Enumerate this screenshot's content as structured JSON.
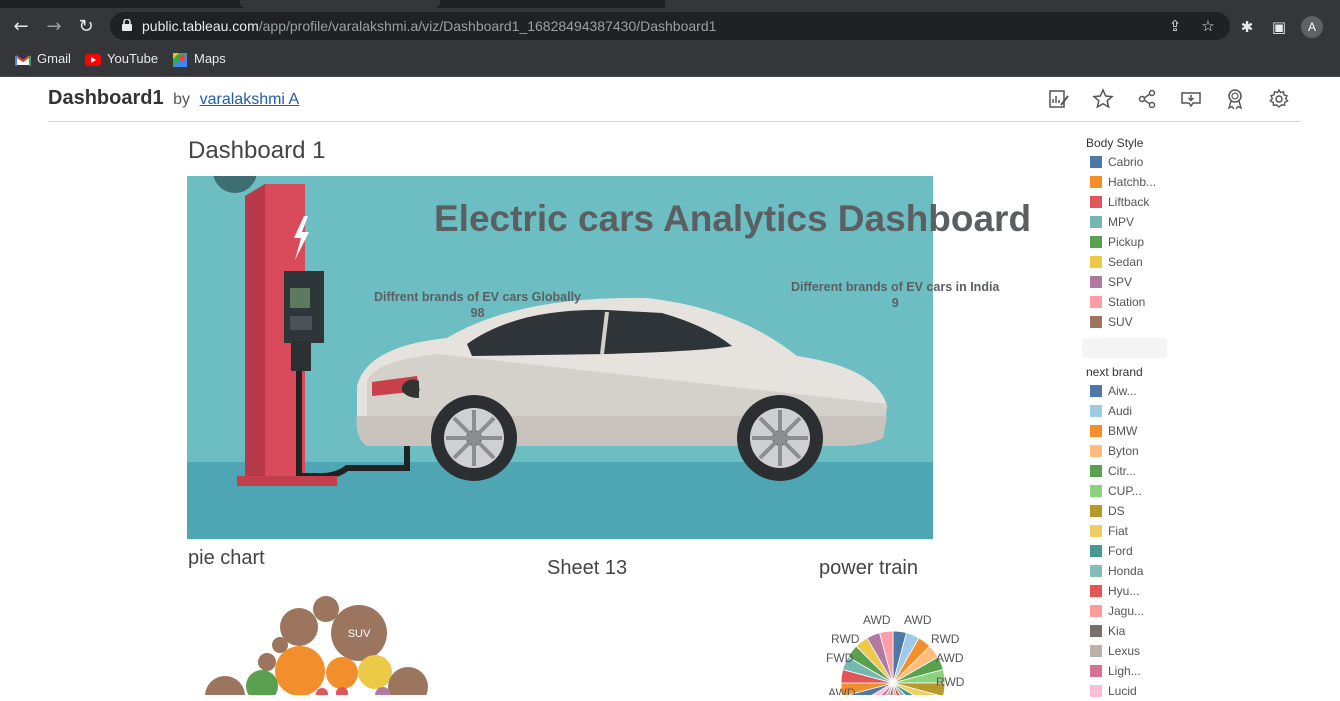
{
  "browser": {
    "url_host": "public.tableau.com",
    "url_path": "/app/profile/varalakshmi.a/viz/Dashboard1_16828494387430/Dashboard1",
    "profile_initial": "A",
    "bookmarks": [
      "Gmail",
      "YouTube",
      "Maps"
    ]
  },
  "viz": {
    "title": "Dashboard1",
    "by": "by",
    "author": "varalakshmi A"
  },
  "dashboard": {
    "title": "Dashboard 1",
    "main_title": "Electric cars Analytics Dashboard",
    "kpi_global_label": "Diffrent brands of EV cars Globally",
    "kpi_global_value": "98",
    "kpi_india_label": "Different brands of EV cars in India",
    "kpi_india_value": "9",
    "sheets": [
      "pie chart",
      "Sheet 13",
      "power train"
    ],
    "bubble_label": "SUV"
  },
  "legend_body_style": {
    "title": "Body Style",
    "items": [
      {
        "label": "Cabrio",
        "color": "#4e79a7"
      },
      {
        "label": "Hatchb...",
        "color": "#f28e2b"
      },
      {
        "label": "Liftback",
        "color": "#e15759"
      },
      {
        "label": "MPV",
        "color": "#76b7b2"
      },
      {
        "label": "Pickup",
        "color": "#59a14f"
      },
      {
        "label": "Sedan",
        "color": "#edc948"
      },
      {
        "label": "SPV",
        "color": "#b07aa1"
      },
      {
        "label": "Station",
        "color": "#ff9da7"
      },
      {
        "label": "SUV",
        "color": "#9c755f"
      }
    ]
  },
  "legend_brand": {
    "title": "next brand",
    "items": [
      {
        "label": "Aiw...",
        "color": "#4e79a7"
      },
      {
        "label": "Audi",
        "color": "#a0cbe8"
      },
      {
        "label": "BMW",
        "color": "#f28e2b"
      },
      {
        "label": "Byton",
        "color": "#ffbe7d"
      },
      {
        "label": "Citr...",
        "color": "#59a14f"
      },
      {
        "label": "CUP...",
        "color": "#8cd17d"
      },
      {
        "label": "DS",
        "color": "#b6992d"
      },
      {
        "label": "Fiat",
        "color": "#f1ce63"
      },
      {
        "label": "Ford",
        "color": "#499894"
      },
      {
        "label": "Honda",
        "color": "#86bcb6"
      },
      {
        "label": "Hyu...",
        "color": "#e15759"
      },
      {
        "label": "Jagu...",
        "color": "#ff9d9a"
      },
      {
        "label": "Kia",
        "color": "#79706e"
      },
      {
        "label": "Lexus",
        "color": "#bab0ac"
      },
      {
        "label": "Ligh...",
        "color": "#d37295"
      },
      {
        "label": "Lucid",
        "color": "#fabfd2"
      }
    ]
  },
  "power_train_labels": [
    "AWD",
    "AWD",
    "RWD",
    "RWD",
    "FWD",
    "AWD",
    "RWD",
    "AWD"
  ]
}
